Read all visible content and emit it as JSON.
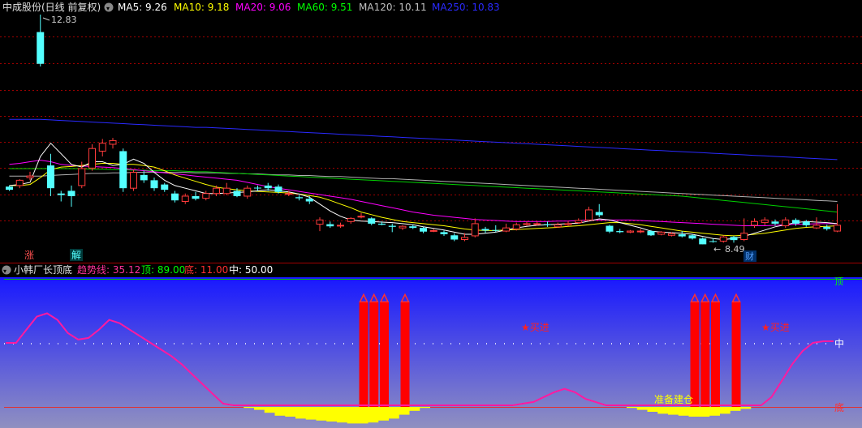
{
  "main_panel": {
    "title": "中成股份(日线 前复权)",
    "ma": [
      {
        "label": "MA5: 9.26",
        "color": "#ffffff"
      },
      {
        "label": "MA10: 9.18",
        "color": "#ffff00"
      },
      {
        "label": "MA20: 9.06",
        "color": "#ff00ff"
      },
      {
        "label": "MA60: 9.51",
        "color": "#00ff00"
      },
      {
        "label": "MA120: 10.11",
        "color": "#c0c0c0"
      },
      {
        "label": "MA250: 10.83",
        "color": "#2a2aff"
      }
    ],
    "high_label": "12.83",
    "low_label": "8.49",
    "marker_zhang": "涨",
    "marker_jie": "解",
    "marker_cai": "财",
    "candles": [
      [
        9.58,
        9.52,
        9.6,
        9.5
      ],
      [
        9.6,
        9.7,
        9.72,
        9.55
      ],
      [
        9.75,
        9.78,
        9.86,
        9.7
      ],
      [
        12.5,
        11.9,
        12.83,
        11.85
      ],
      [
        9.98,
        9.55,
        10.2,
        9.4
      ],
      [
        9.45,
        9.42,
        9.5,
        9.3
      ],
      [
        9.5,
        9.4,
        9.6,
        9.2
      ],
      [
        9.6,
        9.92,
        10.05,
        9.55
      ],
      [
        9.93,
        10.3,
        10.38,
        9.88
      ],
      [
        10.25,
        10.4,
        10.48,
        10.15
      ],
      [
        10.38,
        10.45,
        10.5,
        10.3
      ],
      [
        10.25,
        9.55,
        10.3,
        9.48
      ],
      [
        9.55,
        9.85,
        9.9,
        9.5
      ],
      [
        9.8,
        9.7,
        9.88,
        9.65
      ],
      [
        9.7,
        9.55,
        9.75,
        9.5
      ],
      [
        9.62,
        9.52,
        9.65,
        9.48
      ],
      [
        9.45,
        9.32,
        9.5,
        9.28
      ],
      [
        9.3,
        9.4,
        9.45,
        9.25
      ],
      [
        9.4,
        9.35,
        9.48,
        9.32
      ],
      [
        9.36,
        9.45,
        9.5,
        9.32
      ],
      [
        9.45,
        9.55,
        9.6,
        9.4
      ],
      [
        9.45,
        9.55,
        9.65,
        9.42
      ],
      [
        9.5,
        9.4,
        9.55,
        9.38
      ],
      [
        9.4,
        9.55,
        9.6,
        9.35
      ],
      [
        9.56,
        9.55,
        9.6,
        9.5
      ],
      [
        9.6,
        9.55,
        9.65,
        9.5
      ],
      [
        9.58,
        9.48,
        9.62,
        9.45
      ],
      [
        9.45,
        9.45,
        9.5,
        9.4
      ],
      [
        9.38,
        9.36,
        9.42,
        9.32
      ],
      [
        9.35,
        9.3,
        9.4,
        9.25
      ],
      [
        8.87,
        8.95,
        9.0,
        8.74
      ],
      [
        8.87,
        8.83,
        8.92,
        8.8
      ],
      [
        8.85,
        8.85,
        8.9,
        8.8
      ],
      [
        8.92,
        8.98,
        9.0,
        8.88
      ],
      [
        9.02,
        9.02,
        9.08,
        8.98
      ],
      [
        8.98,
        8.88,
        9.0,
        8.85
      ],
      [
        8.88,
        8.86,
        8.92,
        8.85
      ],
      [
        8.84,
        8.82,
        8.88,
        8.72
      ],
      [
        8.8,
        8.83,
        8.85,
        8.76
      ],
      [
        8.83,
        8.8,
        8.86,
        8.78
      ],
      [
        8.8,
        8.73,
        8.82,
        8.7
      ],
      [
        8.74,
        8.75,
        8.78,
        8.72
      ],
      [
        8.72,
        8.68,
        8.75,
        8.65
      ],
      [
        8.66,
        8.58,
        8.7,
        8.55
      ],
      [
        8.58,
        8.62,
        8.7,
        8.55
      ],
      [
        8.65,
        8.88,
        8.98,
        8.62
      ],
      [
        8.78,
        8.75,
        8.82,
        8.7
      ],
      [
        8.76,
        8.75,
        8.85,
        8.72
      ],
      [
        8.74,
        8.8,
        8.88,
        8.72
      ],
      [
        8.78,
        8.86,
        8.9,
        8.75
      ],
      [
        8.86,
        8.88,
        8.92,
        8.84
      ],
      [
        8.88,
        8.88,
        8.92,
        8.84
      ],
      [
        8.87,
        8.86,
        8.92,
        8.82
      ],
      [
        8.82,
        8.86,
        8.9,
        8.8
      ],
      [
        8.86,
        8.88,
        8.93,
        8.84
      ],
      [
        8.9,
        8.94,
        8.98,
        8.88
      ],
      [
        8.95,
        9.14,
        9.2,
        8.92
      ],
      [
        9.1,
        9.04,
        9.25,
        9.0
      ],
      [
        8.84,
        8.73,
        8.86,
        8.7
      ],
      [
        8.74,
        8.72,
        8.78,
        8.7
      ],
      [
        8.72,
        8.74,
        8.76,
        8.7
      ],
      [
        8.74,
        8.74,
        8.78,
        8.7
      ],
      [
        8.74,
        8.66,
        8.76,
        8.65
      ],
      [
        8.68,
        8.72,
        8.74,
        8.66
      ],
      [
        8.66,
        8.69,
        8.72,
        8.64
      ],
      [
        8.68,
        8.64,
        8.74,
        8.62
      ],
      [
        8.66,
        8.6,
        8.68,
        8.58
      ],
      [
        8.6,
        8.49,
        8.62,
        8.49
      ],
      [
        8.55,
        8.54,
        8.6,
        8.52
      ],
      [
        8.55,
        8.63,
        8.66,
        8.52
      ],
      [
        8.63,
        8.57,
        8.65,
        8.52
      ],
      [
        8.58,
        8.7,
        8.98,
        8.55
      ],
      [
        8.85,
        8.92,
        8.98,
        8.8
      ],
      [
        8.9,
        8.95,
        9.0,
        8.85
      ],
      [
        8.92,
        8.88,
        8.96,
        8.84
      ],
      [
        8.84,
        8.95,
        9.0,
        8.8
      ],
      [
        8.95,
        8.88,
        8.98,
        8.84
      ],
      [
        8.92,
        8.85,
        8.95,
        8.82
      ],
      [
        8.8,
        8.85,
        9.0,
        8.78
      ],
      [
        8.82,
        8.78,
        8.86,
        8.75
      ],
      [
        8.74,
        8.85,
        9.25,
        8.72
      ]
    ],
    "ma5": [
      9.6,
      9.62,
      9.66,
      10.15,
      10.4,
      10.2,
      10.0,
      9.95,
      10.05,
      10.05,
      9.98,
      10.0,
      10.1,
      10.02,
      9.85,
      9.7,
      9.6,
      9.55,
      9.5,
      9.45,
      9.45,
      9.46,
      9.47,
      9.48,
      9.5,
      9.52,
      9.5,
      9.48,
      9.44,
      9.38,
      9.25,
      9.12,
      9.02,
      8.95,
      8.93,
      8.92,
      8.91,
      8.9,
      8.88,
      8.86,
      8.82,
      8.79,
      8.76,
      8.72,
      8.68,
      8.68,
      8.7,
      8.72,
      8.76,
      8.8,
      8.83,
      8.85,
      8.86,
      8.87,
      8.88,
      8.89,
      8.93,
      8.97,
      8.95,
      8.9,
      8.85,
      8.8,
      8.74,
      8.72,
      8.71,
      8.7,
      8.68,
      8.64,
      8.6,
      8.58,
      8.6,
      8.64,
      8.7,
      8.76,
      8.82,
      8.86,
      8.9,
      8.92,
      8.91,
      8.9,
      8.88
    ],
    "ma10": [
      9.6,
      9.6,
      9.62,
      9.75,
      9.9,
      9.95,
      9.96,
      9.98,
      10.0,
      10.02,
      10.02,
      10.0,
      10.0,
      9.98,
      9.95,
      9.88,
      9.8,
      9.74,
      9.68,
      9.62,
      9.57,
      9.54,
      9.52,
      9.5,
      9.49,
      9.48,
      9.47,
      9.46,
      9.44,
      9.41,
      9.38,
      9.32,
      9.25,
      9.18,
      9.1,
      9.05,
      9.0,
      8.96,
      8.92,
      8.9,
      8.88,
      8.86,
      8.84,
      8.81,
      8.78,
      8.76,
      8.75,
      8.75,
      8.76,
      8.77,
      8.78,
      8.79,
      8.8,
      8.81,
      8.83,
      8.84,
      8.86,
      8.88,
      8.9,
      8.9,
      8.88,
      8.86,
      8.83,
      8.8,
      8.77,
      8.74,
      8.72,
      8.7,
      8.68,
      8.66,
      8.65,
      8.66,
      8.68,
      8.7,
      8.73,
      8.76,
      8.79,
      8.81,
      8.82,
      8.83,
      8.84
    ],
    "ma20": [
      10.0,
      10.02,
      10.05,
      10.08,
      10.05,
      10.0,
      9.98,
      9.97,
      9.96,
      9.95,
      9.94,
      9.92,
      9.9,
      9.88,
      9.86,
      9.84,
      9.82,
      9.8,
      9.78,
      9.76,
      9.74,
      9.72,
      9.7,
      9.66,
      9.62,
      9.58,
      9.55,
      9.52,
      9.49,
      9.46,
      9.43,
      9.4,
      9.37,
      9.34,
      9.3,
      9.26,
      9.22,
      9.18,
      9.14,
      9.1,
      9.07,
      9.04,
      9.02,
      9.0,
      8.98,
      8.96,
      8.95,
      8.94,
      8.93,
      8.92,
      8.92,
      8.92,
      8.92,
      8.93,
      8.93,
      8.94,
      8.95,
      8.95,
      8.95,
      8.95,
      8.95,
      8.94,
      8.93,
      8.92,
      8.91,
      8.9,
      8.89,
      8.88,
      8.87,
      8.86,
      8.85,
      8.84,
      8.84,
      8.84,
      8.85,
      8.86,
      8.87,
      8.87,
      8.88,
      8.88,
      8.88
    ],
    "ma60": [
      9.92,
      9.92,
      9.92,
      9.92,
      9.92,
      9.92,
      9.92,
      9.92,
      9.91,
      9.91,
      9.9,
      9.9,
      9.89,
      9.89,
      9.88,
      9.88,
      9.88,
      9.87,
      9.86,
      9.86,
      9.85,
      9.84,
      9.83,
      9.82,
      9.81,
      9.8,
      9.79,
      9.78,
      9.77,
      9.76,
      9.75,
      9.74,
      9.73,
      9.72,
      9.71,
      9.7,
      9.69,
      9.68,
      9.67,
      9.66,
      9.65,
      9.64,
      9.63,
      9.62,
      9.61,
      9.6,
      9.59,
      9.58,
      9.57,
      9.56,
      9.55,
      9.54,
      9.53,
      9.52,
      9.51,
      9.5,
      9.49,
      9.48,
      9.47,
      9.46,
      9.45,
      9.44,
      9.43,
      9.42,
      9.41,
      9.4,
      9.38,
      9.36,
      9.34,
      9.32,
      9.3,
      9.28,
      9.26,
      9.24,
      9.22,
      9.2,
      9.18,
      9.16,
      9.14,
      9.12,
      9.1
    ],
    "ma120": [
      9.78,
      9.78,
      9.78,
      9.78,
      9.79,
      9.8,
      9.81,
      9.82,
      9.83,
      9.83,
      9.84,
      9.84,
      9.85,
      9.85,
      9.85,
      9.85,
      9.85,
      9.85,
      9.84,
      9.84,
      9.84,
      9.83,
      9.83,
      9.82,
      9.82,
      9.81,
      9.8,
      9.8,
      9.79,
      9.79,
      9.78,
      9.77,
      9.77,
      9.76,
      9.75,
      9.74,
      9.73,
      9.73,
      9.72,
      9.71,
      9.7,
      9.69,
      9.68,
      9.67,
      9.66,
      9.65,
      9.64,
      9.63,
      9.62,
      9.61,
      9.6,
      9.59,
      9.58,
      9.57,
      9.56,
      9.55,
      9.54,
      9.53,
      9.52,
      9.51,
      9.5,
      9.49,
      9.48,
      9.47,
      9.46,
      9.45,
      9.44,
      9.43,
      9.42,
      9.41,
      9.4,
      9.39,
      9.38,
      9.37,
      9.36,
      9.35,
      9.34,
      9.33,
      9.32,
      9.31,
      9.3
    ],
    "ma250": [
      10.85,
      10.85,
      10.85,
      10.85,
      10.84,
      10.83,
      10.82,
      10.81,
      10.8,
      10.79,
      10.78,
      10.77,
      10.76,
      10.75,
      10.74,
      10.73,
      10.72,
      10.71,
      10.7,
      10.7,
      10.69,
      10.68,
      10.67,
      10.66,
      10.65,
      10.64,
      10.63,
      10.62,
      10.61,
      10.6,
      10.59,
      10.58,
      10.57,
      10.56,
      10.55,
      10.54,
      10.53,
      10.52,
      10.51,
      10.5,
      10.49,
      10.48,
      10.47,
      10.46,
      10.45,
      10.44,
      10.43,
      10.42,
      10.41,
      10.4,
      10.39,
      10.38,
      10.37,
      10.36,
      10.35,
      10.34,
      10.33,
      10.32,
      10.31,
      10.3,
      10.29,
      10.28,
      10.27,
      10.26,
      10.25,
      10.24,
      10.23,
      10.22,
      10.21,
      10.2,
      10.19,
      10.18,
      10.17,
      10.16,
      10.15,
      10.14,
      10.13,
      10.12,
      10.11,
      10.1,
      10.09
    ]
  },
  "indicator": {
    "title": "小韩厂长顶底",
    "trend_label": "趋势线: 35.12",
    "top_label": "顶: 89.00",
    "bottom_label": "底: 11.00",
    "mid_label": "中: 50.00",
    "axis_top": "顶",
    "axis_mid": "中",
    "axis_bottom": "底",
    "buy1": "★买进",
    "buy2": "★买进",
    "prepare": "准备建仓",
    "trend": [
      50,
      50,
      58,
      66,
      68,
      64,
      56,
      52,
      53,
      58,
      64,
      62,
      58,
      54,
      50,
      46,
      42,
      37,
      31,
      25,
      19,
      13,
      12,
      12,
      12,
      12,
      12,
      12,
      12,
      12,
      12,
      12,
      12,
      12,
      12,
      12,
      12,
      12,
      12,
      12,
      12,
      12,
      12,
      12,
      12,
      12,
      12,
      12,
      12,
      12,
      13,
      14,
      17,
      20,
      22,
      20,
      16,
      14,
      12,
      12,
      12,
      12,
      12,
      12,
      12,
      12,
      12,
      12,
      12,
      12,
      12,
      12,
      12,
      12,
      17,
      27,
      37,
      45,
      50,
      51,
      51
    ],
    "yellow_area": [
      0,
      0,
      0,
      0,
      0,
      0,
      0,
      0,
      0,
      0,
      0,
      0,
      0,
      0,
      0,
      0,
      0,
      0,
      0,
      0,
      0,
      0,
      0,
      1,
      3,
      6,
      9,
      10,
      12,
      13,
      14,
      15,
      16,
      17,
      17,
      16,
      14,
      12,
      8,
      4,
      1,
      0,
      0,
      0,
      0,
      0,
      0,
      0,
      0,
      0,
      0,
      0,
      0,
      0,
      0,
      0,
      0,
      0,
      0,
      0,
      1,
      3,
      5,
      7,
      8,
      9,
      10,
      10,
      9,
      7,
      4,
      2,
      0,
      0,
      0,
      0,
      0,
      0,
      0,
      0,
      0
    ],
    "red_bars": [
      {
        "index": 34,
        "value": 75
      },
      {
        "index": 35,
        "value": 75
      },
      {
        "index": 36,
        "value": 75
      },
      {
        "index": 38,
        "value": 75
      },
      {
        "index": 66,
        "value": 75
      },
      {
        "index": 67,
        "value": 75
      },
      {
        "index": 68,
        "value": 75
      },
      {
        "index": 70,
        "value": 75
      }
    ]
  }
}
